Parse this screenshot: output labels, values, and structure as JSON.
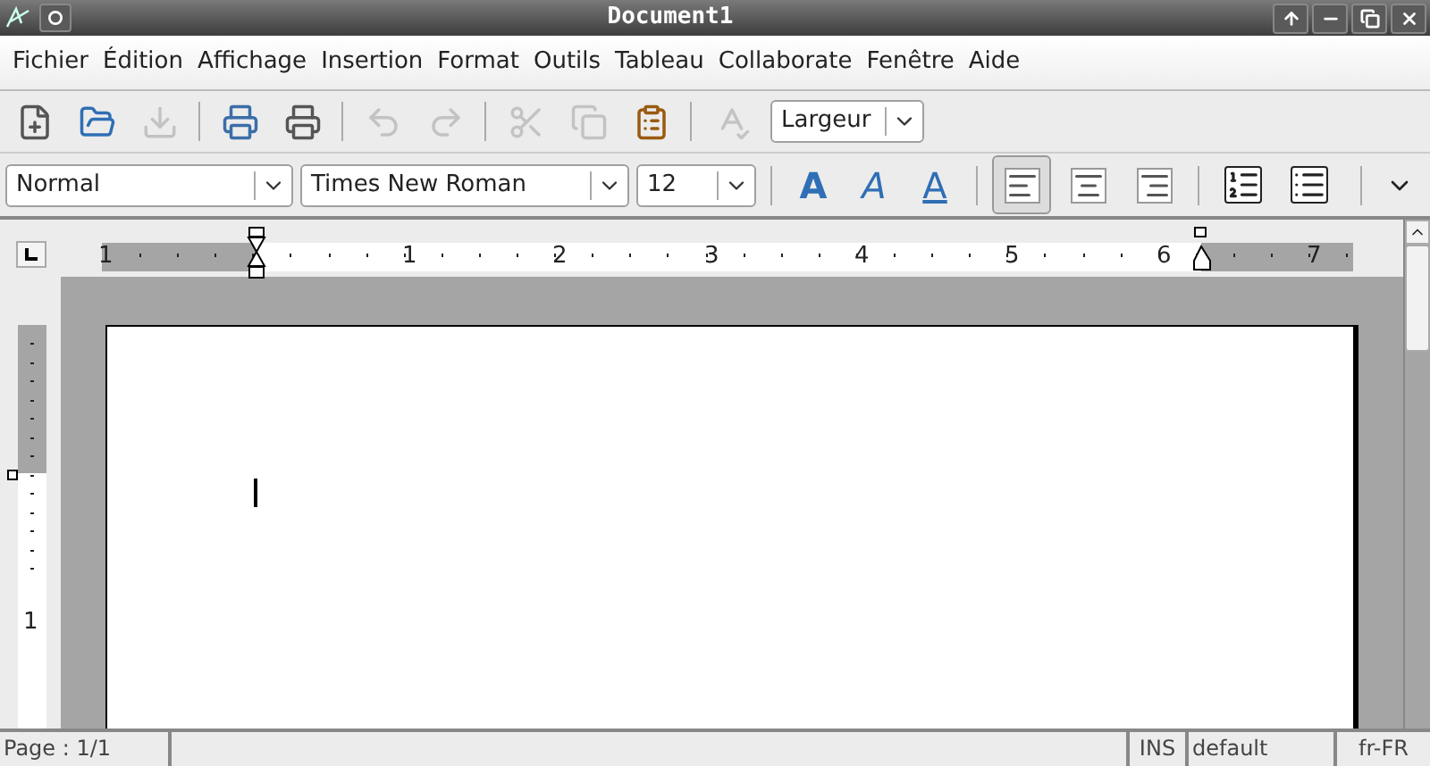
{
  "window": {
    "title": "Document1"
  },
  "menu": [
    {
      "label": "Fichier"
    },
    {
      "label": "Édition"
    },
    {
      "label": "Affichage"
    },
    {
      "label": "Insertion"
    },
    {
      "label": "Format"
    },
    {
      "label": "Outils"
    },
    {
      "label": "Tableau"
    },
    {
      "label": "Collaborate"
    },
    {
      "label": "Fenêtre"
    },
    {
      "label": "Aide"
    }
  ],
  "toolbar": {
    "buttons": [
      {
        "kind": "new",
        "disabled": false
      },
      {
        "kind": "open",
        "disabled": false
      },
      {
        "kind": "save",
        "disabled": true
      },
      {
        "kind": "sep"
      },
      {
        "kind": "preview",
        "disabled": false
      },
      {
        "kind": "print",
        "disabled": false
      },
      {
        "kind": "sep"
      },
      {
        "kind": "undo",
        "disabled": true
      },
      {
        "kind": "redo",
        "disabled": true
      },
      {
        "kind": "sep"
      },
      {
        "kind": "cut",
        "disabled": true
      },
      {
        "kind": "copy",
        "disabled": true
      },
      {
        "kind": "paste",
        "disabled": false
      },
      {
        "kind": "sep"
      },
      {
        "kind": "spell",
        "disabled": true
      }
    ],
    "zoom": {
      "value": "Largeur"
    }
  },
  "format_bar": {
    "style": {
      "value": "Normal"
    },
    "font": {
      "value": "Times New Roman"
    },
    "size": {
      "value": "12"
    },
    "text_buttons": [
      {
        "kind": "bold",
        "label": "A",
        "on": false
      },
      {
        "kind": "italic",
        "label": "A",
        "on": false
      },
      {
        "kind": "underline",
        "label": "A",
        "on": false
      }
    ],
    "align_buttons": [
      {
        "kind": "left",
        "selected": true
      },
      {
        "kind": "center",
        "selected": false
      },
      {
        "kind": "right",
        "selected": false
      }
    ],
    "list_buttons": [
      {
        "kind": "numbered"
      },
      {
        "kind": "bullets"
      }
    ]
  },
  "ruler": {
    "labels": [
      "1",
      "1",
      "2",
      "3",
      "4",
      "5",
      "6",
      "7"
    ],
    "vertical_labels": [
      "1"
    ]
  },
  "status_bar": {
    "page": "Page : 1/1",
    "mode": "INS",
    "style": "default",
    "language": "fr-FR"
  }
}
